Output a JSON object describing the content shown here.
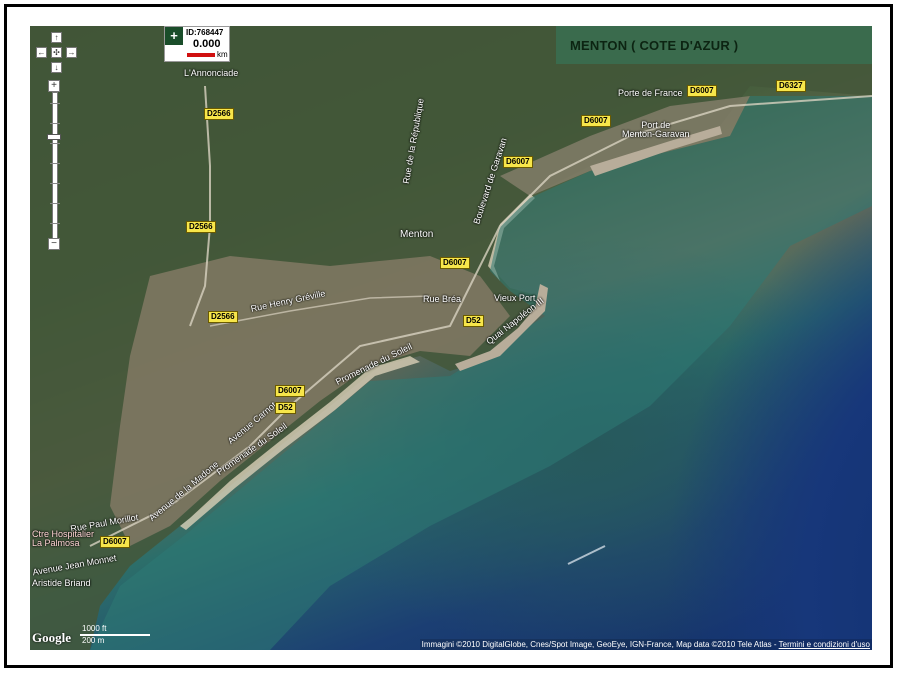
{
  "title": "MENTON ( COTE D'AZUR )",
  "measure": {
    "id_label": "ID:768447",
    "value": "0.000",
    "unit": "km",
    "add_symbol": "+"
  },
  "zoom": {
    "plus": "+",
    "minus": "−"
  },
  "nav": {
    "up": "↑",
    "down": "↓",
    "left": "←",
    "right": "→",
    "center": "✣"
  },
  "places": {
    "annonciade": "L'Annonciade",
    "menton": "Menton",
    "vieux_port": "Vieux Port",
    "port_de_france": "Porte de France",
    "port_menton_garavan": "Port de\nMenton-Garavan",
    "rue_henry_greville": "Rue Henry Gréville",
    "rue_brea": "Rue Bréa",
    "quai_napoleon": "Quai Napoléon III",
    "promenade_du_soleil_1": "Promenade du Soleil",
    "promenade_du_soleil_2": "Promenade du Soleil",
    "avenue_carnot": "Avenue Carnot",
    "avenue_de_la_madone": "Avenue de la Madone",
    "rue_paul_morillot": "Rue Paul Morillot",
    "centre_hospitalier": "Ctre Hospitalier\nLa Palmosa",
    "avenue_jean_monnet": "Avenue Jean Monnet",
    "aristide_briand": "Aristide Briand",
    "rue_de_la_republique": "Rue de la République",
    "boulevard_de_garavan": "Boulevard de Garavan"
  },
  "roads": {
    "d2566_a": "D2566",
    "d2566_b": "D2566",
    "d2566_c": "D2566",
    "d6007_a": "D6007",
    "d6007_b": "D6007",
    "d6007_c": "D6007",
    "d6007_d": "D6007",
    "d6007_e": "D6007",
    "d6007_f": "D6007",
    "d6327": "D6327",
    "d52_a": "D52",
    "d52_b": "D52"
  },
  "scale": {
    "feet": "1000 ft",
    "meters": "200 m"
  },
  "google_logo": "Google",
  "attribution": {
    "text": "Immagini ©2010 DigitalGlobe, Cnes/Spot Image, GeoEye, IGN-France, Map data ©2010 Tele Atlas - ",
    "terms_link": "Termini e condizioni d'uso"
  },
  "colors": {
    "banner": "#3a6b4d",
    "banner_text": "#0c2412",
    "road_shield": "#f7e64a",
    "sea_deep": "#132f66",
    "sea_shallow": "#2c6e6a"
  }
}
